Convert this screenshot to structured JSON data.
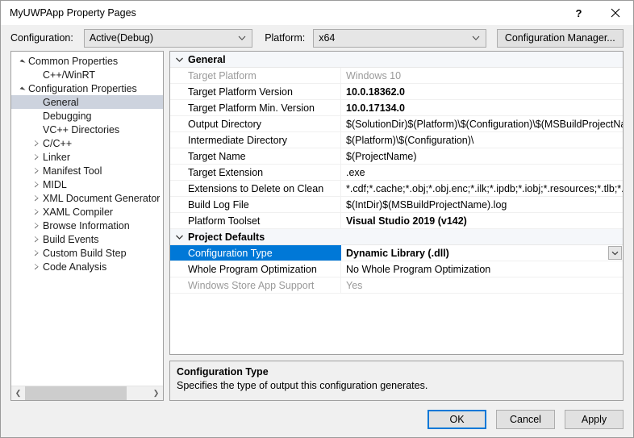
{
  "window": {
    "title": "MyUWPApp Property Pages",
    "help_glyph": "?",
    "close_glyph": "✕"
  },
  "configbar": {
    "configuration_label": "Configuration:",
    "configuration_value": "Active(Debug)",
    "platform_label": "Platform:",
    "platform_value": "x64",
    "configuration_manager_label": "Configuration Manager..."
  },
  "tree": {
    "nodes": [
      {
        "label": "Common Properties",
        "indent": 0,
        "state": "expanded",
        "selected": false
      },
      {
        "label": "C++/WinRT",
        "indent": 1,
        "state": "leaf",
        "selected": false
      },
      {
        "label": "Configuration Properties",
        "indent": 0,
        "state": "expanded",
        "selected": false
      },
      {
        "label": "General",
        "indent": 1,
        "state": "leaf",
        "selected": true
      },
      {
        "label": "Debugging",
        "indent": 1,
        "state": "leaf",
        "selected": false
      },
      {
        "label": "VC++ Directories",
        "indent": 1,
        "state": "leaf",
        "selected": false
      },
      {
        "label": "C/C++",
        "indent": 1,
        "state": "collapsed",
        "selected": false
      },
      {
        "label": "Linker",
        "indent": 1,
        "state": "collapsed",
        "selected": false
      },
      {
        "label": "Manifest Tool",
        "indent": 1,
        "state": "collapsed",
        "selected": false
      },
      {
        "label": "MIDL",
        "indent": 1,
        "state": "collapsed",
        "selected": false
      },
      {
        "label": "XML Document Generator",
        "indent": 1,
        "state": "collapsed",
        "selected": false
      },
      {
        "label": "XAML Compiler",
        "indent": 1,
        "state": "collapsed",
        "selected": false
      },
      {
        "label": "Browse Information",
        "indent": 1,
        "state": "collapsed",
        "selected": false
      },
      {
        "label": "Build Events",
        "indent": 1,
        "state": "collapsed",
        "selected": false
      },
      {
        "label": "Custom Build Step",
        "indent": 1,
        "state": "collapsed",
        "selected": false
      },
      {
        "label": "Code Analysis",
        "indent": 1,
        "state": "collapsed",
        "selected": false
      }
    ],
    "scrollbar": {
      "left_glyph": "❮",
      "right_glyph": "❯"
    }
  },
  "grid": {
    "categories": [
      {
        "name": "General",
        "expanded": true,
        "rows": [
          {
            "name": "Target Platform",
            "value": "Windows 10",
            "disabled": true,
            "bold": false,
            "selected": false
          },
          {
            "name": "Target Platform Version",
            "value": "10.0.18362.0",
            "disabled": false,
            "bold": true,
            "selected": false
          },
          {
            "name": "Target Platform Min. Version",
            "value": "10.0.17134.0",
            "disabled": false,
            "bold": true,
            "selected": false
          },
          {
            "name": "Output Directory",
            "value": "$(SolutionDir)$(Platform)\\$(Configuration)\\$(MSBuildProjectName)\\",
            "disabled": false,
            "bold": false,
            "selected": false
          },
          {
            "name": "Intermediate Directory",
            "value": "$(Platform)\\$(Configuration)\\",
            "disabled": false,
            "bold": false,
            "selected": false
          },
          {
            "name": "Target Name",
            "value": "$(ProjectName)",
            "disabled": false,
            "bold": false,
            "selected": false
          },
          {
            "name": "Target Extension",
            "value": ".exe",
            "disabled": false,
            "bold": false,
            "selected": false
          },
          {
            "name": "Extensions to Delete on Clean",
            "value": "*.cdf;*.cache;*.obj;*.obj.enc;*.ilk;*.ipdb;*.iobj;*.resources;*.tlb;*.tli;*.tlh;*.tmp",
            "disabled": false,
            "bold": false,
            "selected": false
          },
          {
            "name": "Build Log File",
            "value": "$(IntDir)$(MSBuildProjectName).log",
            "disabled": false,
            "bold": false,
            "selected": false
          },
          {
            "name": "Platform Toolset",
            "value": "Visual Studio 2019 (v142)",
            "disabled": false,
            "bold": true,
            "selected": false
          }
        ]
      },
      {
        "name": "Project Defaults",
        "expanded": true,
        "rows": [
          {
            "name": "Configuration Type",
            "value": "Dynamic Library (.dll)",
            "disabled": false,
            "bold": true,
            "selected": true,
            "has_dropdown": true
          },
          {
            "name": "Whole Program Optimization",
            "value": "No Whole Program Optimization",
            "disabled": false,
            "bold": false,
            "selected": false
          },
          {
            "name": "Windows Store App Support",
            "value": "Yes",
            "disabled": true,
            "bold": false,
            "selected": false
          }
        ]
      }
    ]
  },
  "description": {
    "title": "Configuration Type",
    "text": "Specifies the type of output this configuration generates."
  },
  "footer": {
    "ok_label": "OK",
    "cancel_label": "Cancel",
    "apply_label": "Apply"
  },
  "colors": {
    "selection_blue": "#0078d7",
    "tree_selection": "#cdd3de",
    "dialog_bg": "#f0f0f0"
  }
}
